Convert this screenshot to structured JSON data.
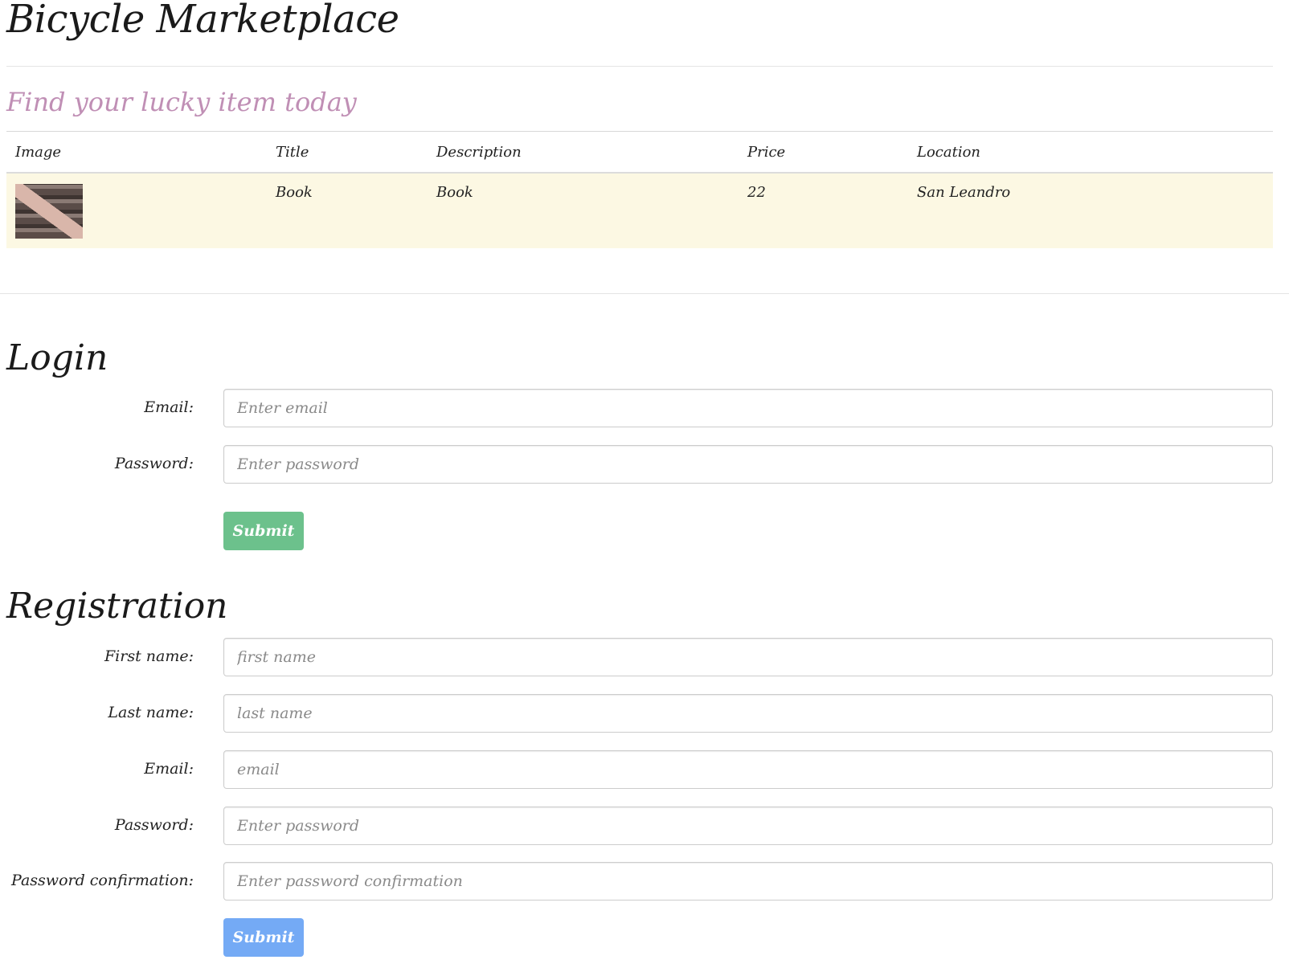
{
  "site": {
    "title": "Bicycle Marketplace"
  },
  "listing": {
    "tagline": "Find your lucky item today",
    "columns": [
      "Image",
      "Title",
      "Description",
      "Price",
      "Location"
    ],
    "rows": [
      {
        "title": "Book",
        "description": "Book",
        "price": "22",
        "location": "San Leandro"
      }
    ]
  },
  "login": {
    "heading": "Login",
    "email_label": "Email:",
    "email_placeholder": "Enter email",
    "password_label": "Password:",
    "password_placeholder": "Enter password",
    "submit_label": "Submit"
  },
  "registration": {
    "heading": "Registration",
    "first_name_label": "First name:",
    "first_name_placeholder": "first name",
    "last_name_label": "Last name:",
    "last_name_placeholder": "last name",
    "email_label": "Email:",
    "email_placeholder": "email",
    "password_label": "Password:",
    "password_placeholder": "Enter password",
    "password_confirmation_label": "Password confirmation:",
    "password_confirmation_placeholder": "Enter password confirmation",
    "submit_label": "Submit"
  },
  "colors": {
    "tagline": "#c08fb5",
    "row_highlight": "#fcf8e3",
    "login_button": "#6cc18c",
    "registration_button": "#74aaf5"
  }
}
